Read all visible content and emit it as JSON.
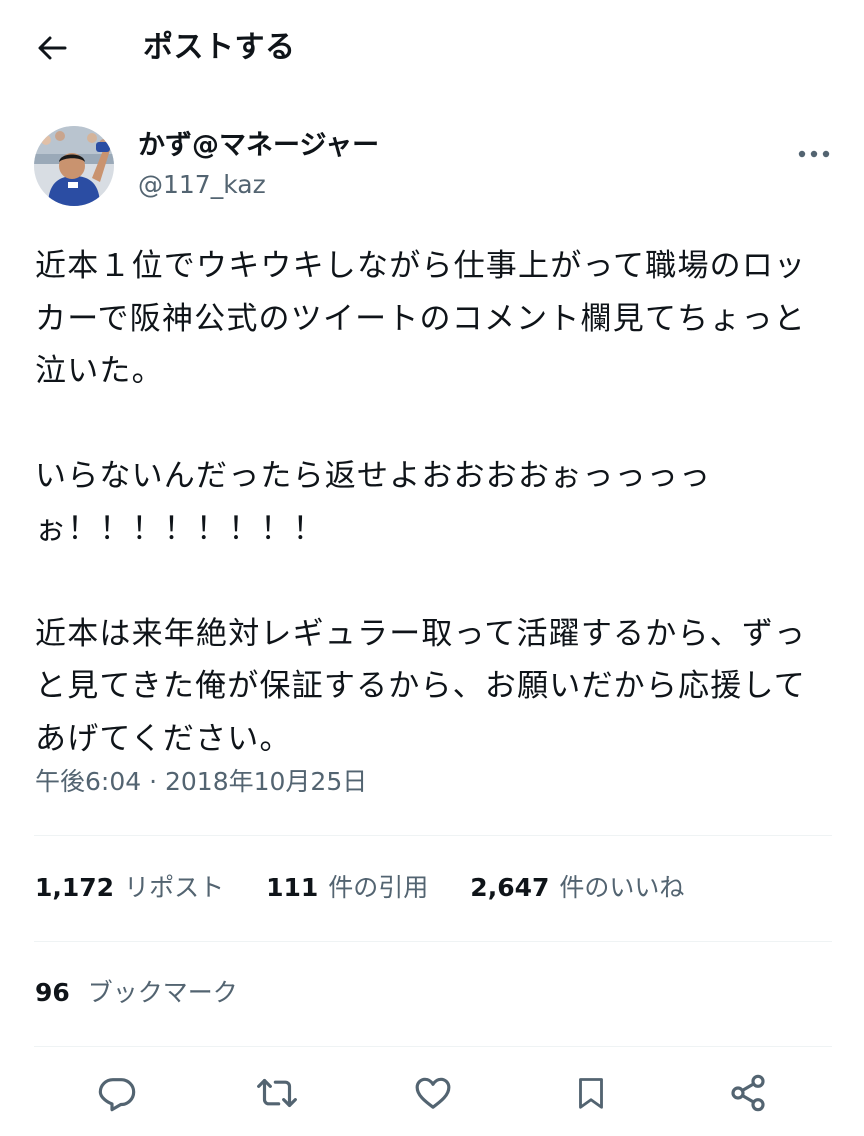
{
  "header": {
    "title": "ポストする",
    "back_icon": "arrow-left-icon"
  },
  "author": {
    "display_name": "かず@マネージャー",
    "handle": "@117_kaz",
    "more_icon": "more-horizontal-icon"
  },
  "tweet": {
    "text": "近本１位でウキウキしながら仕事上がって職場のロッカーで阪神公式のツイートのコメント欄見てちょっと泣いた。\n\nいらないんだったら返せよおおおおぉっっっっぉ！！！！！！！！\n\n近本は来年絶対レギュラー取って活躍するから、ずっと見てきた俺が保証するから、お願いだから応援してあげてください。",
    "timestamp_time": "午後6:04",
    "timestamp_sep": "·",
    "timestamp_date": "2018年10月25日"
  },
  "stats": {
    "reposts_count": "1,172",
    "reposts_label": "リポスト",
    "quotes_count": "111",
    "quotes_label": "件の引用",
    "likes_count": "2,647",
    "likes_label": "件のいいね",
    "bookmarks_count": "96",
    "bookmarks_label": "ブックマーク"
  },
  "actions": [
    {
      "icon": "reply-icon"
    },
    {
      "icon": "repost-icon"
    },
    {
      "icon": "like-icon"
    },
    {
      "icon": "bookmark-icon"
    },
    {
      "icon": "share-icon"
    }
  ],
  "colors": {
    "text": "#0f1419",
    "secondary": "#536471",
    "divider": "#eff3f4"
  }
}
